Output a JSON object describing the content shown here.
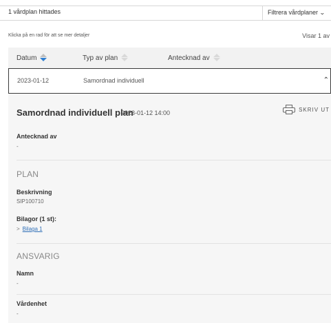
{
  "toolbar": {
    "result_count": "1 vårdplan hittades",
    "filter_label": "Filtrera vårdplaner",
    "filter_icon": "chevron-down-icon"
  },
  "list": {
    "hint": "Klicka på en rad för att se mer detaljer",
    "showing": "Visar 1 av"
  },
  "table": {
    "columns": [
      {
        "label": "Datum",
        "sort": "descending"
      },
      {
        "label": "Typ av plan",
        "sort": "none"
      },
      {
        "label": "Antecknad av",
        "sort": "none"
      }
    ],
    "rows": [
      {
        "date": "2023-01-12",
        "type": "Samordnad individuell",
        "author": "",
        "expanded": true
      }
    ]
  },
  "detail": {
    "title": "Samordnad individuell plan",
    "datetime": "2023-01-12 14:00",
    "print_label": "SKRIV UT",
    "print_icon": "printer-icon",
    "author_label": "Antecknad av",
    "author_value": "-",
    "plan_section": "PLAN",
    "description_label": "Beskrivning",
    "description_value": "SIP100710",
    "attachments_label": "Bilagor (1 st):",
    "attachments": [
      "Bilaga 1"
    ],
    "responsible_section": "ANSVARIG",
    "name_label": "Namn",
    "name_value": "-",
    "unit_label": "Vårdenhet",
    "unit_value": "-"
  },
  "colors": {
    "accent": "#2f7fd1",
    "link": "#2f6fb7",
    "header_bg": "#f2f2f2",
    "detail_bg": "#f6f6f6"
  }
}
